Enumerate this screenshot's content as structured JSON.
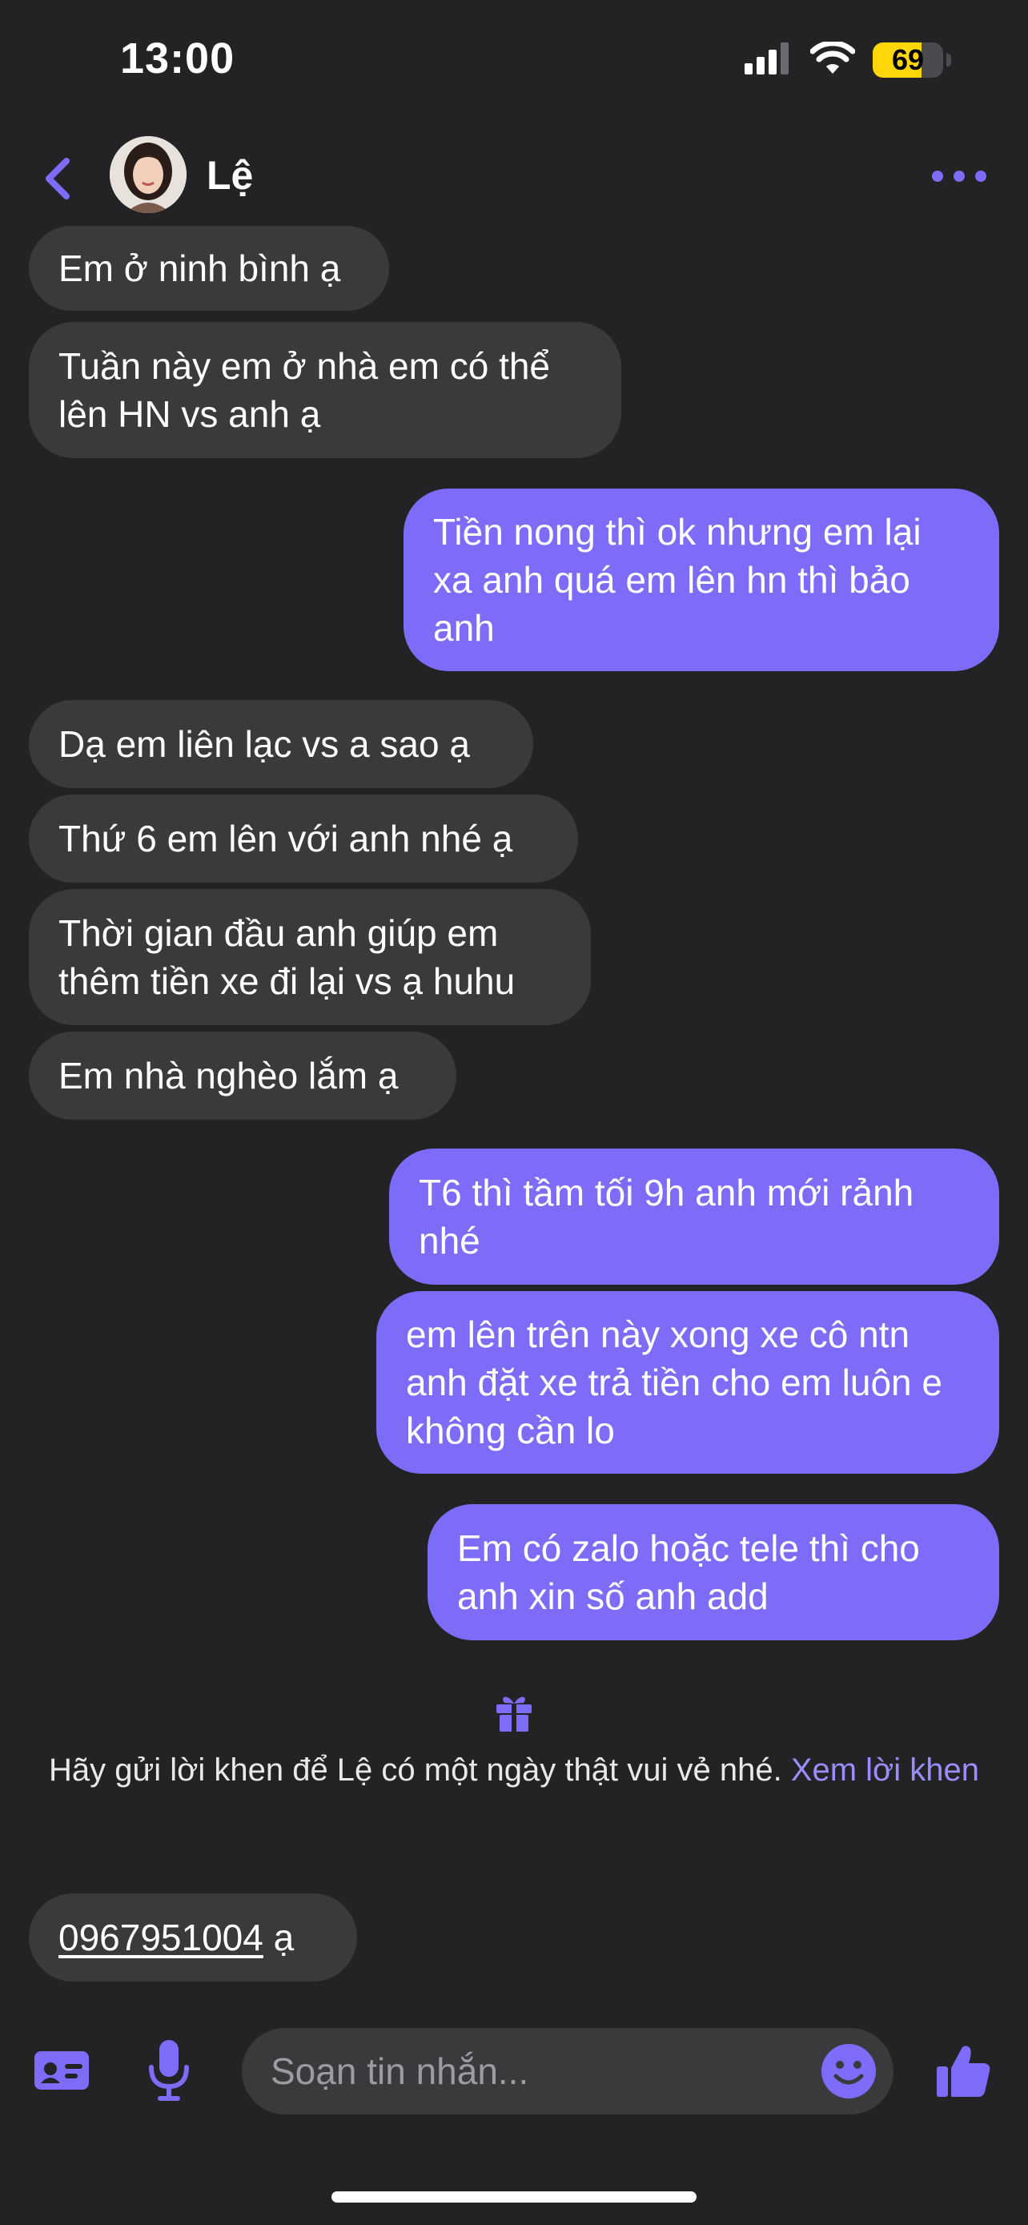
{
  "status_bar": {
    "time": "13:00",
    "battery_level": "69",
    "battery_fraction": 0.69,
    "signal_icon": "cellular-signal-icon",
    "wifi_icon": "wifi-icon"
  },
  "header": {
    "contact_name": "Lệ",
    "back_icon": "chevron-left-icon",
    "more_icon": "more-dots-icon"
  },
  "messages": [
    {
      "direction": "received",
      "text": "Em ở ninh bình ạ"
    },
    {
      "direction": "received",
      "text": "Tuần này em ở nhà em có thể lên HN vs anh ạ"
    },
    {
      "direction": "sent",
      "text": "Tiền nong thì ok nhưng em lại xa anh quá em lên hn thì bảo anh"
    },
    {
      "direction": "received",
      "text": "Dạ em liên lạc vs a sao ạ"
    },
    {
      "direction": "received",
      "text": "Thứ 6 em lên với anh nhé ạ"
    },
    {
      "direction": "received",
      "text": "Thời gian đầu anh giúp em thêm tiền xe đi lại vs ạ huhu"
    },
    {
      "direction": "received",
      "text": "Em nhà nghèo lắm ạ"
    },
    {
      "direction": "sent",
      "text": "T6 thì tầm tối 9h anh mới rảnh nhé"
    },
    {
      "direction": "sent",
      "text": "em lên trên này xong xe cô ntn anh đặt xe trả tiền cho em luôn e không cần lo"
    },
    {
      "direction": "sent",
      "text": "Em có zalo hoặc tele thì cho anh xin số anh add"
    }
  ],
  "compliment_prompt": {
    "text": "Hãy gửi lời khen để Lệ có một ngày thật vui vẻ nhé. ",
    "link_text": "Xem lời khen",
    "icon": "gift-icon"
  },
  "last_message": {
    "direction": "received",
    "phone": "0967951004",
    "suffix": " ạ"
  },
  "composer": {
    "placeholder": "Soạn tin nhắn...",
    "icons": [
      "contact-card-icon",
      "microphone-icon",
      "emoji-icon",
      "thumbs-up-icon"
    ]
  },
  "colors": {
    "background": "#232326",
    "received_bubble": "#3a3a3d",
    "sent_bubble": "#7c6cf8",
    "accent": "#7c6cf8",
    "battery": "#ffd60a"
  }
}
